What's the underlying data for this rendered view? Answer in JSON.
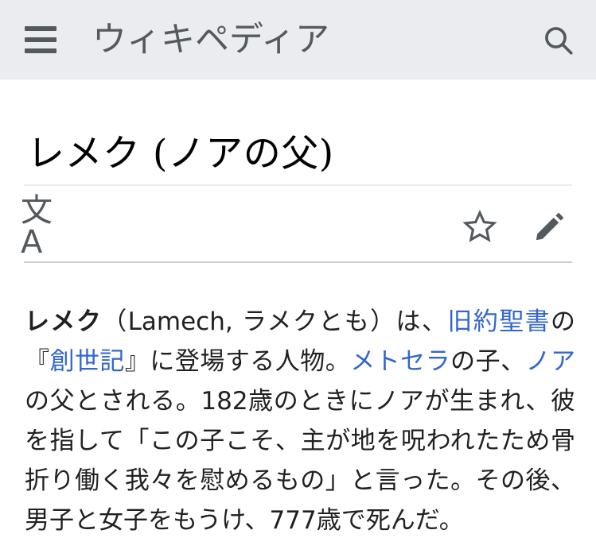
{
  "header": {
    "menu_icon": "hamburger-menu-icon",
    "wordmark": "ウィキペディア",
    "search_icon": "search-icon",
    "background_color": "#eaecf0",
    "icon_color": "#54595d"
  },
  "article": {
    "title": "レメク (ノアの父)",
    "actions": [
      {
        "name": "language",
        "icon": "translate-icon",
        "glyph": "文A"
      },
      {
        "name": "watch",
        "icon": "star-outline-icon"
      },
      {
        "name": "edit",
        "icon": "pencil-icon"
      }
    ],
    "lead": {
      "segments": [
        {
          "type": "bold",
          "text": "レメク"
        },
        {
          "type": "plain",
          "text": "（Lamech, ラメクとも）は、"
        },
        {
          "type": "link",
          "text": "旧約聖書"
        },
        {
          "type": "plain",
          "text": "の『"
        },
        {
          "type": "link",
          "text": "創世記"
        },
        {
          "type": "plain",
          "text": "』に登場する人物。"
        },
        {
          "type": "link",
          "text": "メトセラ"
        },
        {
          "type": "plain",
          "text": "の子、"
        },
        {
          "type": "link",
          "text": "ノア"
        },
        {
          "type": "plain",
          "text": "の父とされる。182歳のときにノアが生まれ、彼を指して「この子こそ、主が地を呪われたため骨折り働く我々を慰めるもの」と言った。その後、男子と女子をもうけ、777歳で死んだ。"
        }
      ],
      "plain_text": "レメク（Lamech, ラメクとも）は、旧約聖書の『創世記』に登場する人物。メトセラの子、ノアの父とされる。182歳のときにノアが生まれ、彼を指して「この子こそ、主が地を呪われたため骨折り働く我々を慰めるもの」と言った。その後、男子と女子をもうけ、777歳で死んだ。",
      "link_color": "#3366cc",
      "text_color": "#202122"
    }
  }
}
